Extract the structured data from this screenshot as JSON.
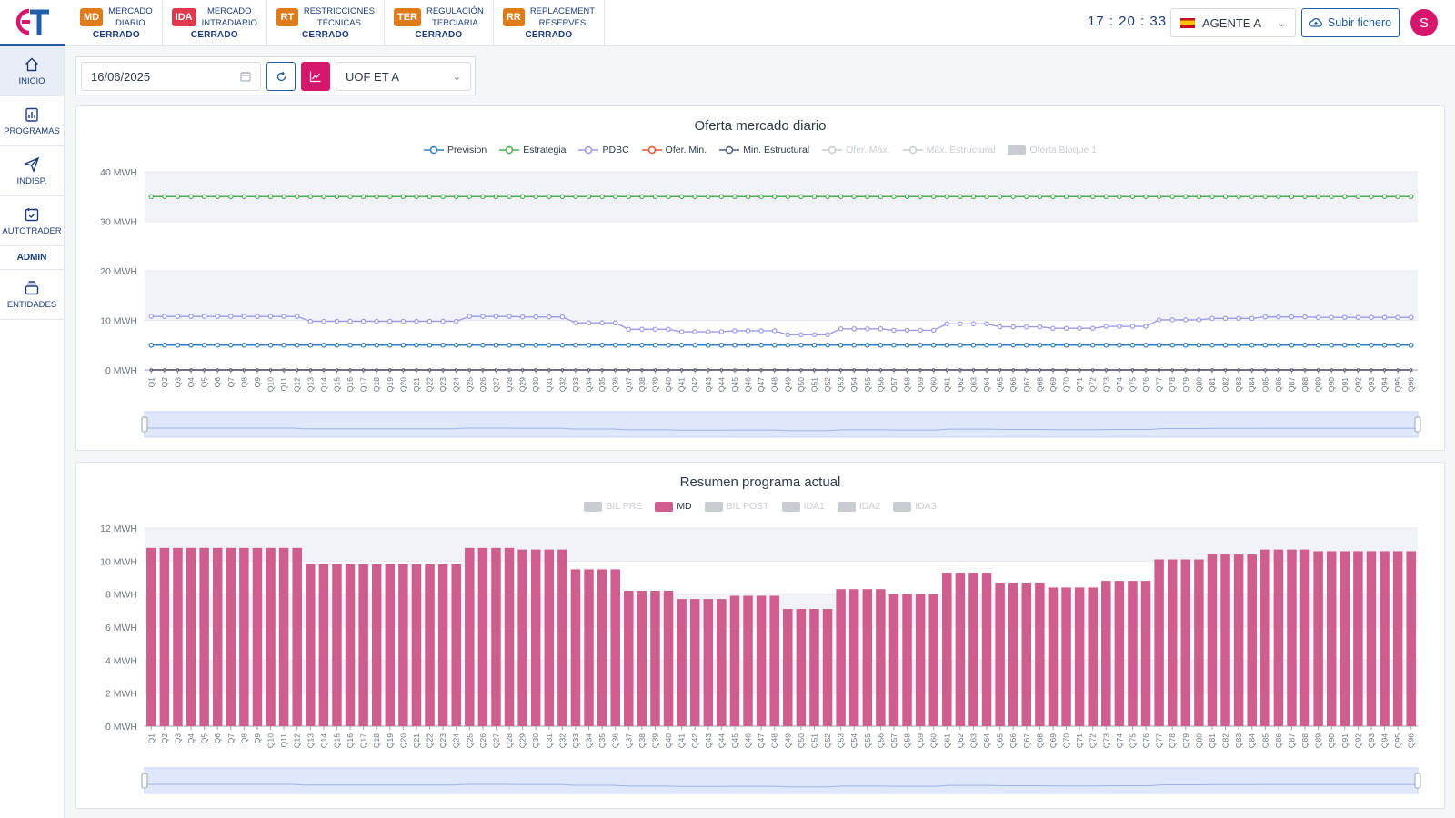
{
  "app": {
    "logo_text": "ET"
  },
  "markets": [
    {
      "code": "MD",
      "name_l1": "MERCADO",
      "name_l2": "DIARIO",
      "status": "CERRADO",
      "color": "#e07b1a"
    },
    {
      "code": "IDA",
      "name_l1": "MERCADO",
      "name_l2": "INTRADIARIO",
      "status": "CERRADO",
      "color": "#e03a4e"
    },
    {
      "code": "RT",
      "name_l1": "RESTRICCIONES",
      "name_l2": "TÉCNICAS",
      "status": "CERRADO",
      "color": "#e07b1a"
    },
    {
      "code": "TER",
      "name_l1": "REGULACIÓN",
      "name_l2": "TERCIARIA",
      "status": "CERRADO",
      "color": "#e07b1a"
    },
    {
      "code": "RR",
      "name_l1": "REPLACEMENT",
      "name_l2": "RESERVES",
      "status": "CERRADO",
      "color": "#e07b1a"
    }
  ],
  "header": {
    "clock": "17 : 20 : 33",
    "agent": "AGENTE A",
    "upload_label": "Subir fichero",
    "avatar_initial": "S"
  },
  "sidebar": {
    "items": [
      {
        "label": "INICIO",
        "icon": "home-icon"
      },
      {
        "label": "PROGRAMAS",
        "icon": "programs-icon"
      },
      {
        "label": "INDISP.",
        "icon": "send-icon"
      },
      {
        "label": "AUTOTRADER",
        "icon": "calendar-check-icon"
      }
    ],
    "admin_label": "ADMIN",
    "admin_items": [
      {
        "label": "ENTIDADES",
        "icon": "entities-icon"
      }
    ]
  },
  "filters": {
    "date": "16/06/2025",
    "unit": "UOF ET A"
  },
  "chart_data": [
    {
      "type": "line",
      "title": "Oferta mercado diario",
      "ylim": [
        0,
        40
      ],
      "yticks": [
        "0 MWH",
        "10 MWH",
        "20 MWH",
        "30 MWH",
        "40 MWH"
      ],
      "x_prefix": "Q",
      "x_count": 96,
      "grid": "horizontal bands",
      "legend": [
        {
          "name": "Prevision",
          "color": "#2f7fc1",
          "active": true
        },
        {
          "name": "Estrategia",
          "color": "#4caf50",
          "active": true
        },
        {
          "name": "PDBC",
          "color": "#9b9bea",
          "active": true
        },
        {
          "name": "Ofer. Min.",
          "color": "#f0522b",
          "active": true
        },
        {
          "name": "Min. Estructural",
          "color": "#4b5d7a",
          "active": true
        },
        {
          "name": "Ofer. Máx.",
          "color": "#c9ccd2",
          "active": false
        },
        {
          "name": "Máx. Estructural",
          "color": "#c9ccd2",
          "active": false
        },
        {
          "name": "Oferta Bloque 1",
          "color": "#c9ccd2",
          "active": false
        }
      ],
      "series": [
        {
          "name": "Prevision",
          "constant": 5
        },
        {
          "name": "Estrategia",
          "constant": 35
        },
        {
          "name": "PDBC",
          "values": [
            10.8,
            10.8,
            10.8,
            10.8,
            10.8,
            10.8,
            10.8,
            10.8,
            10.8,
            10.8,
            10.8,
            10.8,
            9.8,
            9.8,
            9.8,
            9.8,
            9.8,
            9.8,
            9.8,
            9.8,
            9.8,
            9.8,
            9.8,
            9.8,
            10.8,
            10.8,
            10.8,
            10.8,
            10.7,
            10.7,
            10.7,
            10.7,
            9.5,
            9.5,
            9.5,
            9.5,
            8.2,
            8.2,
            8.2,
            8.2,
            7.7,
            7.7,
            7.7,
            7.7,
            7.9,
            7.9,
            7.9,
            7.9,
            7.1,
            7.1,
            7.1,
            7.1,
            8.3,
            8.3,
            8.3,
            8.3,
            8.0,
            8.0,
            8.0,
            8.0,
            9.3,
            9.3,
            9.3,
            9.3,
            8.7,
            8.7,
            8.7,
            8.7,
            8.4,
            8.4,
            8.4,
            8.4,
            8.8,
            8.8,
            8.8,
            8.8,
            10.1,
            10.1,
            10.1,
            10.1,
            10.4,
            10.4,
            10.4,
            10.4,
            10.7,
            10.7,
            10.7,
            10.7,
            10.6,
            10.6,
            10.6,
            10.6,
            10.6,
            10.6,
            10.6,
            10.6
          ]
        },
        {
          "name": "Ofer. Min.",
          "constant": 0
        },
        {
          "name": "Min. Estructural",
          "constant": 0
        }
      ]
    },
    {
      "type": "bar",
      "title": "Resumen programa actual",
      "ylim": [
        0,
        12
      ],
      "yticks": [
        "0 MWH",
        "2 MWH",
        "4 MWH",
        "6 MWH",
        "8 MWH",
        "10 MWH",
        "12 MWH"
      ],
      "x_prefix": "Q",
      "x_count": 96,
      "legend": [
        {
          "name": "BIL PRE",
          "color": "#c9ccd2",
          "active": false
        },
        {
          "name": "MD",
          "color": "#cf5d8d",
          "active": true
        },
        {
          "name": "BIL POST",
          "color": "#c9ccd2",
          "active": false
        },
        {
          "name": "IDA1",
          "color": "#c9ccd2",
          "active": false
        },
        {
          "name": "IDA2",
          "color": "#c9ccd2",
          "active": false
        },
        {
          "name": "IDA3",
          "color": "#c9ccd2",
          "active": false
        }
      ],
      "series": [
        {
          "name": "MD",
          "values": [
            10.8,
            10.8,
            10.8,
            10.8,
            10.8,
            10.8,
            10.8,
            10.8,
            10.8,
            10.8,
            10.8,
            10.8,
            9.8,
            9.8,
            9.8,
            9.8,
            9.8,
            9.8,
            9.8,
            9.8,
            9.8,
            9.8,
            9.8,
            9.8,
            10.8,
            10.8,
            10.8,
            10.8,
            10.7,
            10.7,
            10.7,
            10.7,
            9.5,
            9.5,
            9.5,
            9.5,
            8.2,
            8.2,
            8.2,
            8.2,
            7.7,
            7.7,
            7.7,
            7.7,
            7.9,
            7.9,
            7.9,
            7.9,
            7.1,
            7.1,
            7.1,
            7.1,
            8.3,
            8.3,
            8.3,
            8.3,
            8.0,
            8.0,
            8.0,
            8.0,
            9.3,
            9.3,
            9.3,
            9.3,
            8.7,
            8.7,
            8.7,
            8.7,
            8.4,
            8.4,
            8.4,
            8.4,
            8.8,
            8.8,
            8.8,
            8.8,
            10.1,
            10.1,
            10.1,
            10.1,
            10.4,
            10.4,
            10.4,
            10.4,
            10.7,
            10.7,
            10.7,
            10.7,
            10.6,
            10.6,
            10.6,
            10.6,
            10.6,
            10.6,
            10.6,
            10.6
          ]
        }
      ]
    }
  ]
}
